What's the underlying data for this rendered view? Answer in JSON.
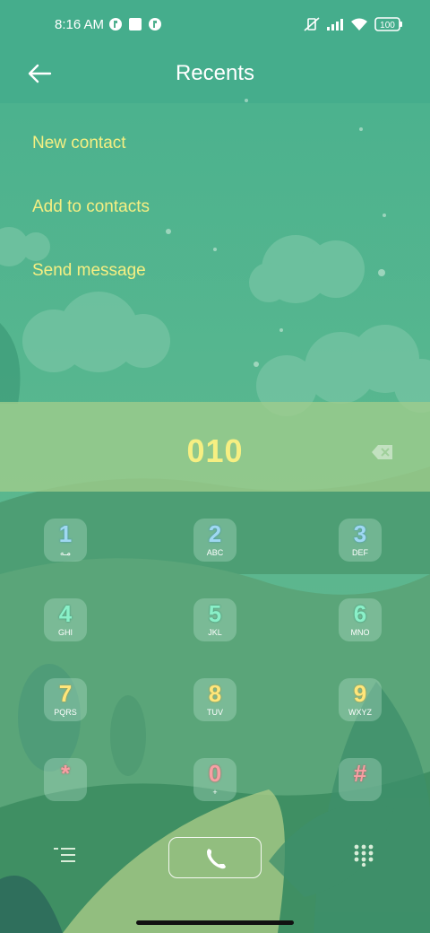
{
  "status_bar": {
    "time": "8:16 AM",
    "battery": "100",
    "icons": [
      "vpn-icon",
      "square-notification-icon",
      "vpn-icon",
      "vibrate-off-icon",
      "signal-icon",
      "wifi-icon",
      "battery-icon"
    ]
  },
  "app_bar": {
    "back_icon": "arrow-left-icon",
    "title": "Recents"
  },
  "menu": {
    "items": [
      {
        "label": "New contact"
      },
      {
        "label": "Add to contacts"
      },
      {
        "label": "Send message"
      }
    ]
  },
  "dialer": {
    "number": "010",
    "backspace_icon": "backspace-icon",
    "keys": [
      {
        "digit": "1",
        "sub": "ﻣـه"
      },
      {
        "digit": "2",
        "sub": "ABC"
      },
      {
        "digit": "3",
        "sub": "DEF"
      },
      {
        "digit": "4",
        "sub": "GHI"
      },
      {
        "digit": "5",
        "sub": "JKL"
      },
      {
        "digit": "6",
        "sub": "MNO"
      },
      {
        "digit": "7",
        "sub": "PQRS"
      },
      {
        "digit": "8",
        "sub": "TUV"
      },
      {
        "digit": "9",
        "sub": "WXYZ"
      },
      {
        "digit": "*",
        "sub": ""
      },
      {
        "digit": "0",
        "sub": "+"
      },
      {
        "digit": "#",
        "sub": ""
      }
    ]
  },
  "bottom_bar": {
    "menu_icon": "menu-icon",
    "call_icon": "phone-icon",
    "keypad_icon": "dialpad-icon"
  },
  "colors": {
    "accent": "#f6ef82",
    "background": "#4fb08e"
  }
}
